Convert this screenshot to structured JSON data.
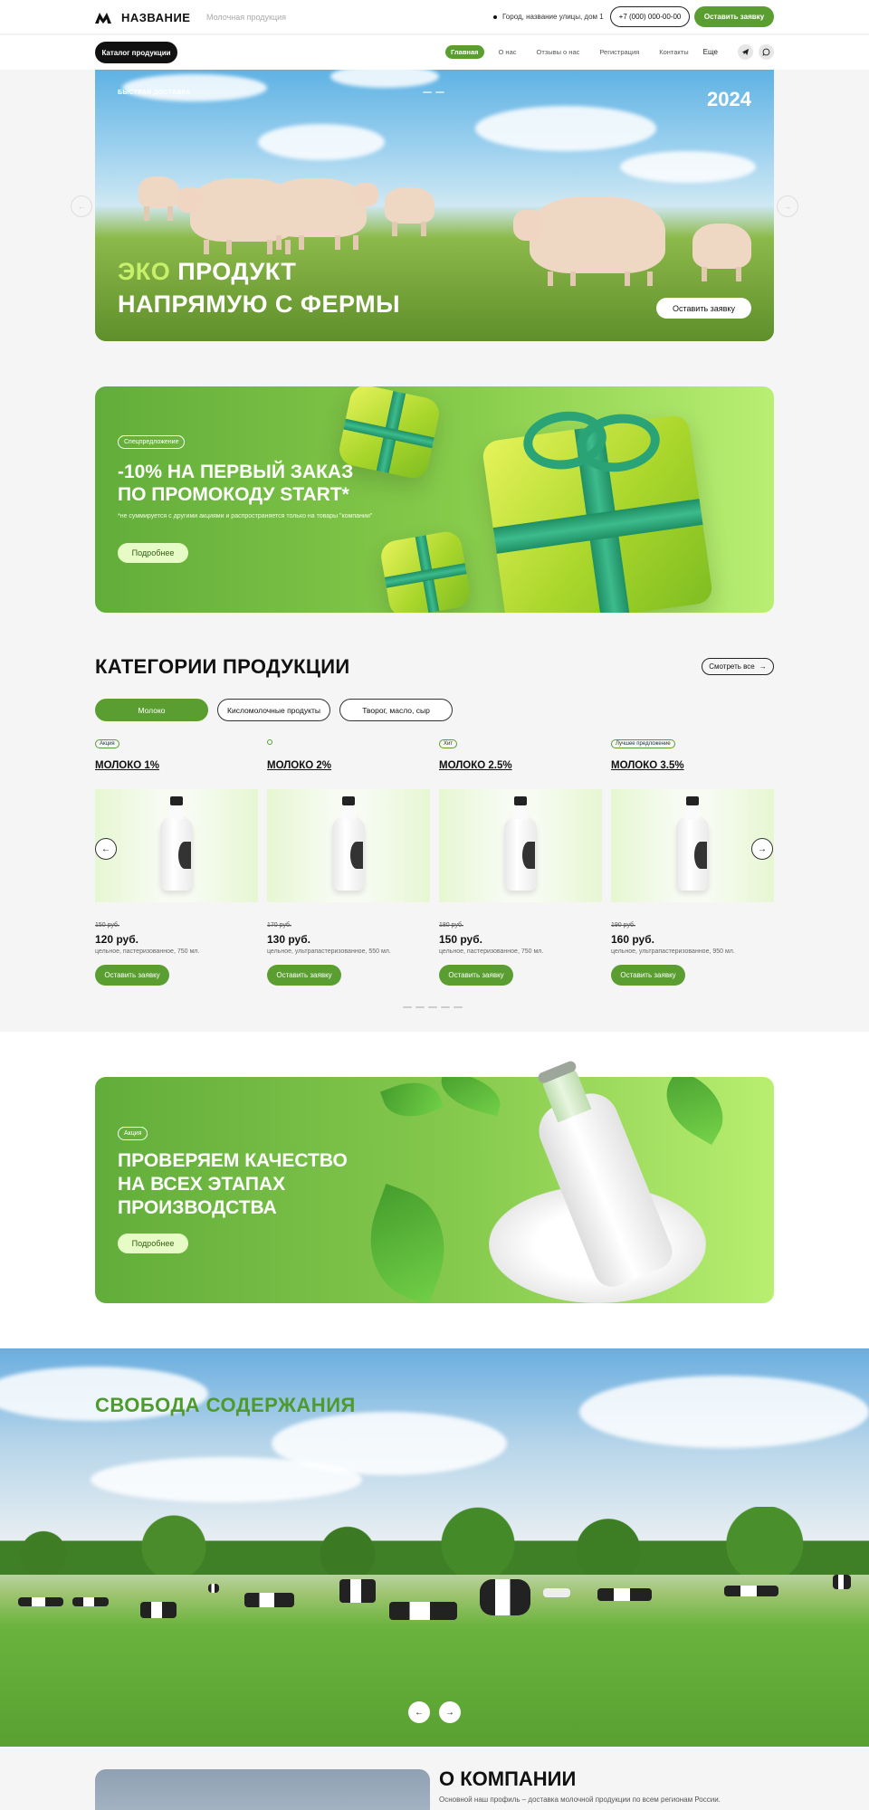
{
  "header": {
    "brand": "НАЗВАНИЕ",
    "tagline": "Молочная продукция",
    "address": "Город, название улицы, дом 1",
    "phone": "+7 (000) 000-00-00",
    "order_button": "Оставить заявку"
  },
  "nav": {
    "catalog_button": "Каталог продукции",
    "links": [
      "Главная",
      "О нас",
      "Отзывы о нас",
      "Регистрация",
      "Контакты"
    ],
    "more": "Еще",
    "social": [
      "telegram-icon",
      "whatsapp-icon"
    ]
  },
  "hero": {
    "tag": "БЫСТРАЯ ДОСТАВКА",
    "year": "2024",
    "title_accent": "ЭКО",
    "title_rest": " ПРОДУКТ",
    "title_line2": "НАПРЯМУЮ С ФЕРМЫ",
    "cta": "Оставить заявку",
    "prev": "←",
    "next": "→"
  },
  "promo1": {
    "badge": "Спецпредложение",
    "title_line1": "-10% НА ПЕРВЫЙ ЗАКАЗ",
    "title_line2": "ПО ПРОМОКОДУ START*",
    "note": "*не суммируется с другими акциями и распространяется только на товары \"компании\"",
    "button": "Подробнее"
  },
  "categories": {
    "title": "КАТЕГОРИИ ПРОДУКЦИИ",
    "see_all": "Смотреть все",
    "see_all_arrow": "→",
    "tabs": [
      "Молоко",
      "Кисломолочные продукты",
      "Творог, масло, сыр"
    ],
    "products": [
      {
        "badge": "Акция",
        "name": "МОЛОКО 1%",
        "old_price": "150 руб.",
        "price": "120 руб.",
        "desc": "цельное, пастеризованное, 750 мл.",
        "button": "Оставить заявку"
      },
      {
        "badge": "",
        "name": "МОЛОКО 2%",
        "old_price": "170 руб.",
        "price": "130 руб.",
        "desc": "цельное, ультрапастеризованное, 550 мл.",
        "button": "Оставить заявку"
      },
      {
        "badge": "Хит",
        "name": "МОЛОКО 2.5%",
        "old_price": "180 руб.",
        "price": "150 руб.",
        "desc": "цельное, пастеризованное, 750 мл.",
        "button": "Оставить заявку"
      },
      {
        "badge": "Лучшее предложение",
        "name": "МОЛОКО 3.5%",
        "old_price": "190 руб.",
        "price": "160 руб.",
        "desc": "цельное, ультрапастеризованное, 950 мл.",
        "button": "Оставить заявку"
      }
    ],
    "prev": "←",
    "next": "→"
  },
  "promo2": {
    "badge": "Акция",
    "title_line1": "ПРОВЕРЯЕМ КАЧЕСТВО",
    "title_line2": "НА ВСЕХ ЭТАПАХ",
    "title_line3": "ПРОИЗВОДСТВА",
    "button": "Подробнее"
  },
  "freedom": {
    "title": "СВОБОДА СОДЕРЖАНИЯ",
    "prev": "←",
    "next": "→"
  },
  "about": {
    "title": "О КОМПАНИИ",
    "text": "Основной наш профиль – доставка молочной продукции по всем регионам России."
  },
  "colors": {
    "accent": "#5a9e32",
    "accent_light": "#c7f06a",
    "dark": "#111111"
  }
}
